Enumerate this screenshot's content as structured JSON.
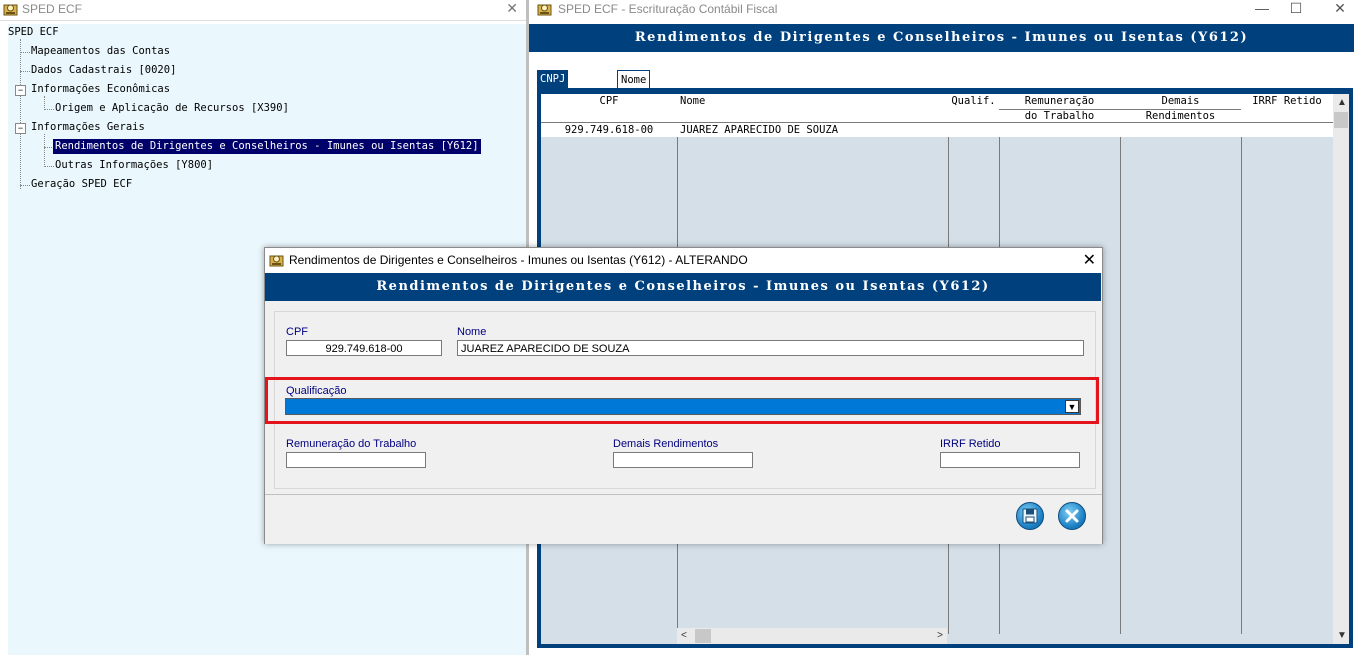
{
  "left_window": {
    "title": "SPED ECF",
    "close": "✕",
    "tree": {
      "root": "SPED ECF",
      "items": [
        {
          "label": "Mapeamentos das Contas"
        },
        {
          "label": "Dados Cadastrais [0020]"
        },
        {
          "label": "Informações Econômicas",
          "expander": "−"
        },
        {
          "label": "Origem e Aplicação de Recursos [X390]"
        },
        {
          "label": "Informações Gerais",
          "expander": "−"
        },
        {
          "label": "Rendimentos de Dirigentes e Conselheiros - Imunes ou Isentas [Y612]",
          "selected": true
        },
        {
          "label": "Outras Informações [Y800]"
        },
        {
          "label": "Geração SPED ECF"
        }
      ]
    }
  },
  "right_window": {
    "title": "SPED ECF  -  Escrituração Contábil Fiscal",
    "controls": {
      "minimize": "—",
      "maximize": "☐",
      "close": "✕"
    },
    "header": "Rendimentos de Dirigentes e Conselheiros - Imunes ou Isentas (Y612)",
    "tabs": [
      "CNPJ / CPF",
      "Nome"
    ],
    "grid": {
      "columns": [
        {
          "l1": "CPF",
          "l2": ""
        },
        {
          "l1": "Nome",
          "l2": ""
        },
        {
          "l1": "Qualif.",
          "l2": ""
        },
        {
          "l1": "Remuneração",
          "l2": "do Trabalho"
        },
        {
          "l1": "Demais",
          "l2": "Rendimentos"
        },
        {
          "l1": "IRRF Retido",
          "l2": ""
        }
      ],
      "rows": [
        {
          "cpf": "929.749.618-00",
          "nome": "JUAREZ APARECIDO DE SOUZA",
          "qualif": "",
          "remuneracao": "",
          "demais": "",
          "irrf": ""
        }
      ]
    },
    "scroll": {
      "up": "▲",
      "down": "▼",
      "left": "<",
      "right": ">"
    }
  },
  "dialog": {
    "title": "Rendimentos de Dirigentes e Conselheiros - Imunes ou Isentas (Y612)  -  ALTERANDO",
    "close": "✕",
    "header": "Rendimentos de Dirigentes e Conselheiros - Imunes ou Isentas (Y612)",
    "fields": {
      "cpf": {
        "label": "CPF",
        "value": "929.749.618-00"
      },
      "nome": {
        "label": "Nome",
        "value": "JUAREZ APARECIDO DE SOUZA"
      },
      "qualificacao": {
        "label": "Qualificação",
        "value": ""
      },
      "remuneracao": {
        "label": "Remuneração do Trabalho",
        "value": ""
      },
      "demais": {
        "label": "Demais Rendimentos",
        "value": ""
      },
      "irrf": {
        "label": "IRRF Retido",
        "value": ""
      }
    },
    "dropdown_arrow": "▼",
    "buttons": {
      "save_icon": "save-icon",
      "cancel_icon": "close-icon"
    },
    "colors": {
      "accent": "#00417d",
      "selection": "#0078d7",
      "highlight": "#e3141c"
    }
  }
}
